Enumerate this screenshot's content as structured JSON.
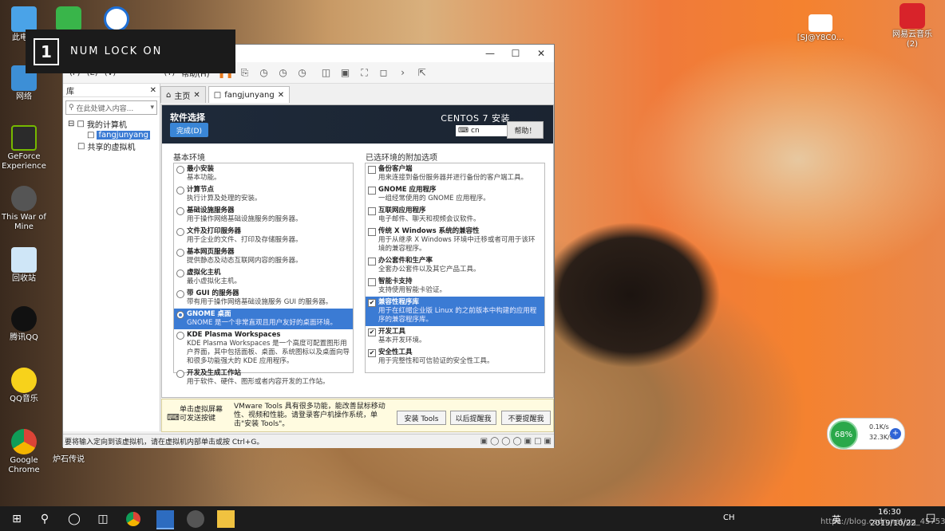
{
  "desktop": {
    "icons": [
      {
        "label": "此电脑",
        "name": "this-pc"
      },
      {
        "label": "网络",
        "name": "network"
      },
      {
        "label": "GeForce Experience",
        "name": "geforce-experience"
      },
      {
        "label": "This War of Mine",
        "name": "this-war-of-mine"
      },
      {
        "label": "回收站",
        "name": "recycle-bin"
      },
      {
        "label": "腾讯QQ",
        "name": "qq"
      },
      {
        "label": "QQ音乐",
        "name": "qq-music"
      },
      {
        "label": "Google Chrome",
        "name": "google-chrome"
      },
      {
        "label": "炉石传说",
        "name": "hearthstone"
      },
      {
        "label": "[SJ@Y8C0...",
        "name": "file-item"
      },
      {
        "label": "网易云音乐 (2)",
        "name": "netease-music"
      }
    ]
  },
  "osd": {
    "text": "NUM LOCK ON",
    "digit": "1"
  },
  "window": {
    "title_fragment": "station",
    "menu": [
      "(F)",
      "(E)",
      "(V)",
      "(T)",
      "帮助(H)"
    ],
    "library": {
      "title": "库",
      "search_placeholder": "在此处键入内容...",
      "tree": [
        "我的计算机",
        "fangjunyang",
        "共享的虚拟机"
      ]
    },
    "tabs": [
      "主页",
      "fangjunyang"
    ],
    "installer": {
      "title": "软件选择",
      "done": "完成(D)",
      "brand": "CENTOS 7 安装",
      "keyboard": "cn",
      "help": "帮助！",
      "left_title": "基本环境",
      "right_title": "已选环境的附加选项",
      "base_env": [
        {
          "title": "最小安装",
          "desc": "基本功能。"
        },
        {
          "title": "计算节点",
          "desc": "执行计算及处理的安装。"
        },
        {
          "title": "基础设施服务器",
          "desc": "用于操作网络基础设施服务的服务器。"
        },
        {
          "title": "文件及打印服务器",
          "desc": "用于企业的文件、打印及存储服务器。"
        },
        {
          "title": "基本网页服务器",
          "desc": "提供静态及动态互联网内容的服务器。"
        },
        {
          "title": "虚拟化主机",
          "desc": "最小虚拟化主机。"
        },
        {
          "title": "带 GUI 的服务器",
          "desc": "带有用于操作网络基础设施服务 GUI 的服务器。"
        },
        {
          "title": "GNOME 桌面",
          "desc": "GNOME 是一个非常直观且用户友好的桌面环境。"
        },
        {
          "title": "KDE Plasma Workspaces",
          "desc": "KDE Plasma Workspaces 是一个高度可配置图形用户界面，其中包括面板、桌面、系统图标以及桌面向导和很多功能强大的 KDE 应用程序。"
        },
        {
          "title": "开发及生成工作站",
          "desc": "用于软件、硬件、图形或者内容开发的工作站。"
        }
      ],
      "addons": [
        {
          "title": "备份客户端",
          "desc": "用来连接到备份服务器并进行备份的客户端工具。",
          "checked": false
        },
        {
          "title": "GNOME 应用程序",
          "desc": "一组经常使用的 GNOME 应用程序。",
          "checked": false
        },
        {
          "title": "互联网应用程序",
          "desc": "电子邮件、聊天和视频会议软件。",
          "checked": false
        },
        {
          "title": "传统 X Windows 系统的兼容性",
          "desc": "用于从继承 X Windows 环境中迁移或者可用于该环境的兼容程序。",
          "checked": false
        },
        {
          "title": "办公套件和生产率",
          "desc": "全套办公套件以及其它产品工具。",
          "checked": false
        },
        {
          "title": "智能卡支持",
          "desc": "支持使用智能卡验证。",
          "checked": false
        },
        {
          "title": "兼容性程序库",
          "desc": "用于在红帽企业版 Linux 的之前版本中构建的应用程序的兼容程序库。",
          "checked": true
        },
        {
          "title": "开发工具",
          "desc": "基本开发环境。",
          "checked": true
        },
        {
          "title": "安全性工具",
          "desc": "用于完整性和可信验证的安全性工具。",
          "checked": true
        }
      ]
    },
    "tools_bar": {
      "hint": "单击虚拟屏幕\n可发送按键",
      "message": "VMware Tools 具有很多功能，能改善鼠标移动性、视频和性能。请登录客户机操作系统，单击\"安装 Tools\"。",
      "install": "安装 Tools",
      "remind": "以后提醒我",
      "never": "不要提醒我"
    },
    "status": "要将输入定向到该虚拟机，请在虚拟机内部单击或按 Ctrl+G。"
  },
  "widget": {
    "percent": "68%",
    "up": "0.1K/s",
    "down": "32.3K/s"
  },
  "taskbar": {
    "time": "16:30",
    "date": "2019/10/22",
    "lang": "英",
    "ime": "CH",
    "watermark": "https://blog.csdn.net/qq_45753240"
  }
}
